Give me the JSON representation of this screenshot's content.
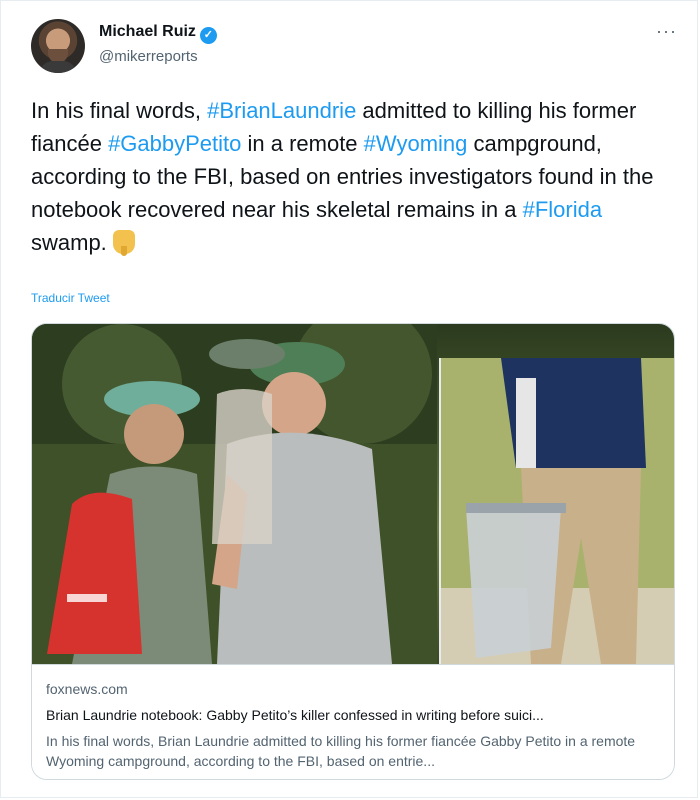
{
  "author": {
    "name": "Michael Ruiz",
    "handle": "@mikerreports",
    "verified_symbol": "✓"
  },
  "more_label": "···",
  "tweet": {
    "segments": [
      {
        "text": "In his final words, ",
        "hashtag": false
      },
      {
        "text": "#BrianLaundrie",
        "hashtag": true
      },
      {
        "text": " admitted to killing his former fiancée ",
        "hashtag": false
      },
      {
        "text": "#GabbyPetito",
        "hashtag": true
      },
      {
        "text": " in a remote ",
        "hashtag": false
      },
      {
        "text": "#Wyoming",
        "hashtag": true
      },
      {
        "text": " campground, according to the FBI, based on entries investigators found in the notebook recovered near his skeletal remains in a ",
        "hashtag": false
      },
      {
        "text": "#Florida",
        "hashtag": true
      },
      {
        "text": " swamp.",
        "hashtag": false
      }
    ],
    "emoji": "pointing-down-icon",
    "translate_label": "Traducir Tweet"
  },
  "card": {
    "domain": "foxnews.com",
    "title": "Brian Laundrie notebook: Gabby Petito’s killer confessed in writing before suici...",
    "description": "In his final words, Brian Laundrie admitted to killing his former fiancée Gabby Petito in a remote Wyoming campground, according to the FBI, based on entrie..."
  },
  "colors": {
    "link": "#1d9bf0",
    "text": "#0f1419",
    "muted": "#536471"
  }
}
